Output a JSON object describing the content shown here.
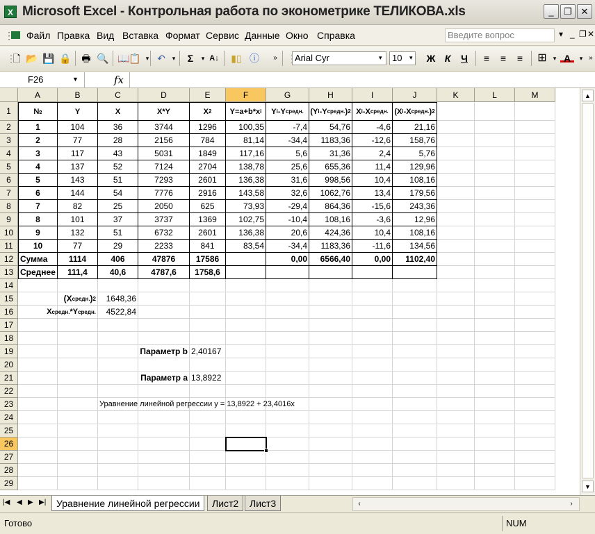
{
  "window": {
    "title": "Microsoft Excel - Контрольная работа по эконометрике ТЕЛИКОВА.xls"
  },
  "menu": {
    "items": [
      "Файл",
      "Правка",
      "Вид",
      "Вставка",
      "Формат",
      "Сервис",
      "Данные",
      "Окно",
      "Справка"
    ],
    "help_placeholder": "Введите вопрос"
  },
  "toolbar": {
    "font": "Arial Cyr",
    "size": "10",
    "bold": "Ж",
    "italic": "К",
    "underline": "Ч"
  },
  "formula": {
    "name_box": "F26",
    "fx": "fx",
    "content": ""
  },
  "sheet": {
    "columns": [
      "A",
      "B",
      "C",
      "D",
      "E",
      "F",
      "G",
      "H",
      "I",
      "J",
      "K",
      "L",
      "M"
    ],
    "rows": [
      "1",
      "2",
      "3",
      "4",
      "5",
      "6",
      "7",
      "8",
      "9",
      "10",
      "11",
      "12",
      "13",
      "14",
      "15",
      "16",
      "17",
      "18",
      "19",
      "20",
      "21",
      "22",
      "23",
      "24",
      "25",
      "26",
      "27",
      "28",
      "29"
    ],
    "header": [
      "№",
      "Y",
      "X",
      "X*Y",
      "X2",
      "Y=a+b*xi",
      "Yi-Yсредн.",
      "(Yi-Yсредн.)2",
      "Xi-Xсредн.",
      "(Xi-Xсредн.)2"
    ],
    "data": [
      [
        "1",
        "104",
        "36",
        "3744",
        "1296",
        "100,35",
        "-7,4",
        "54,76",
        "-4,6",
        "21,16"
      ],
      [
        "2",
        "77",
        "28",
        "2156",
        "784",
        "81,14",
        "-34,4",
        "1183,36",
        "-12,6",
        "158,76"
      ],
      [
        "3",
        "117",
        "43",
        "5031",
        "1849",
        "117,16",
        "5,6",
        "31,36",
        "2,4",
        "5,76"
      ],
      [
        "4",
        "137",
        "52",
        "7124",
        "2704",
        "138,78",
        "25,6",
        "655,36",
        "11,4",
        "129,96"
      ],
      [
        "5",
        "143",
        "51",
        "7293",
        "2601",
        "136,38",
        "31,6",
        "998,56",
        "10,4",
        "108,16"
      ],
      [
        "6",
        "144",
        "54",
        "7776",
        "2916",
        "143,58",
        "32,6",
        "1062,76",
        "13,4",
        "179,56"
      ],
      [
        "7",
        "82",
        "25",
        "2050",
        "625",
        "73,93",
        "-29,4",
        "864,36",
        "-15,6",
        "243,36"
      ],
      [
        "8",
        "101",
        "37",
        "3737",
        "1369",
        "102,75",
        "-10,4",
        "108,16",
        "-3,6",
        "12,96"
      ],
      [
        "9",
        "132",
        "51",
        "6732",
        "2601",
        "136,38",
        "20,6",
        "424,36",
        "10,4",
        "108,16"
      ],
      [
        "10",
        "77",
        "29",
        "2233",
        "841",
        "83,54",
        "-34,4",
        "1183,36",
        "-11,6",
        "134,56"
      ]
    ],
    "sum_row": [
      "Сумма",
      "1114",
      "406",
      "47876",
      "17586",
      "",
      "0,00",
      "6566,40",
      "0,00",
      "1102,40"
    ],
    "avg_row": [
      "Среднее",
      "111,4",
      "40,6",
      "4787,6",
      "1758,6"
    ],
    "x_avg_sq_label": "(Xсредн.)2",
    "x_avg_sq_value": "1648,36",
    "xy_avg_label": "Xсредн.*Yсредн.",
    "xy_avg_value": "4522,84",
    "param_b_label": "Параметр b",
    "param_b_value": "2,40167",
    "param_a_label": "Параметр a",
    "param_a_value": "13,8922",
    "equation": "Уравнение линейной регрессии y = 13,8922 + 23,4016x"
  },
  "tabs": [
    "Уравнение линейной регрессии",
    "Лист2",
    "Лист3"
  ],
  "status": {
    "text": "Готово",
    "num": "NUM"
  },
  "colors": {
    "selected_header": "#f8c760",
    "chrome": "#ece9d8",
    "excel_green": "#1f7a3a"
  }
}
